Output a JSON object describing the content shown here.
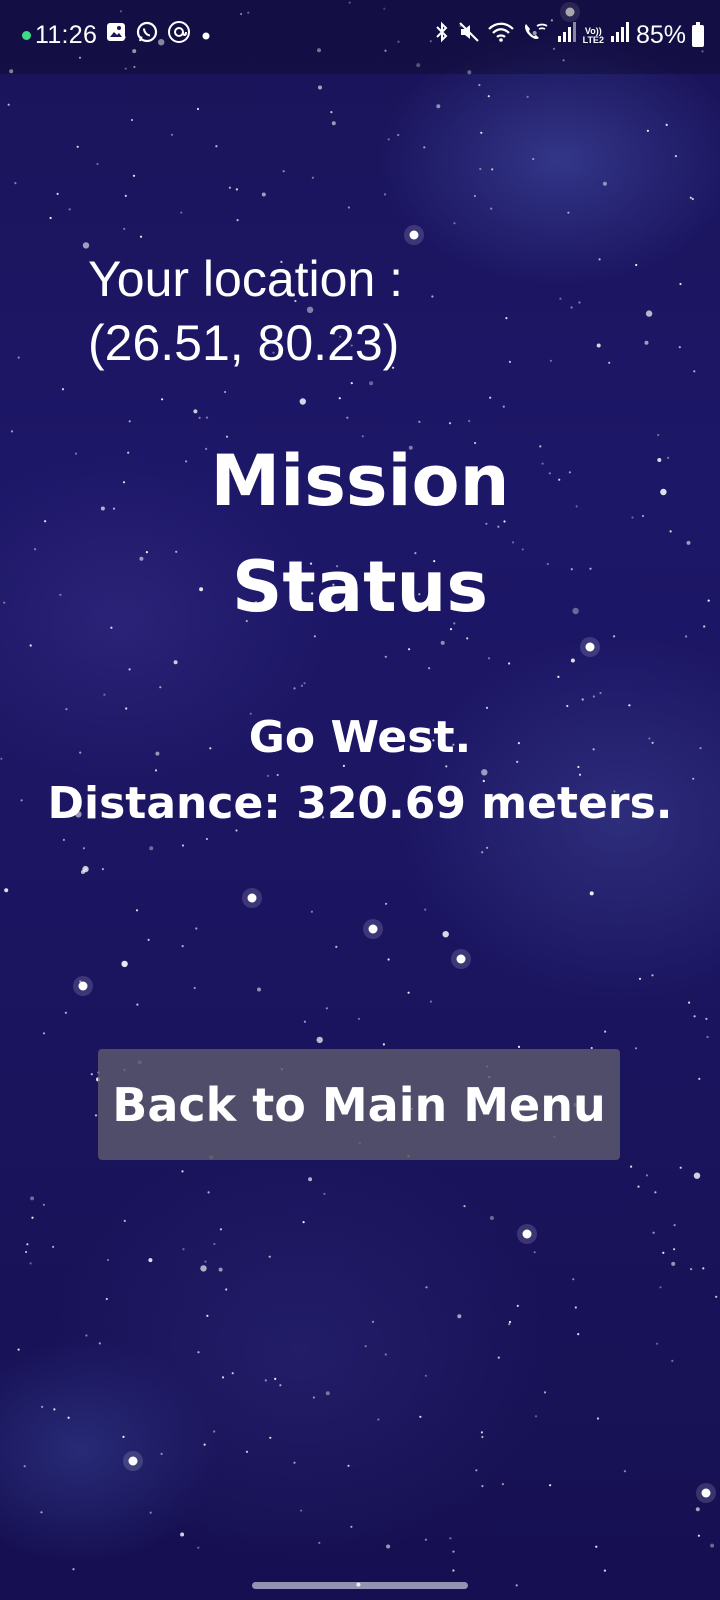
{
  "status_bar": {
    "time": "11:26",
    "notification_icons": [
      "gallery-icon",
      "whatsapp-icon",
      "threads-icon",
      "more-dot-icon"
    ],
    "system_icons": [
      "bluetooth-icon",
      "mute-icon",
      "wifi-icon",
      "wifi-calling-icon",
      "signal-icon",
      "volte-lte-icon",
      "signal-icon"
    ],
    "lte_label_top": "Vo))",
    "lte_label_bottom": "LTE2",
    "battery_percent": "85%"
  },
  "location": {
    "label": "Your location :",
    "coordinates": "(26.51, 80.23)"
  },
  "mission": {
    "title_line1": "Mission",
    "title_line2": "Status",
    "direction": "Go West.",
    "distance": "Distance: 320.69 meters."
  },
  "back_button": {
    "label": "Back to Main Menu"
  }
}
